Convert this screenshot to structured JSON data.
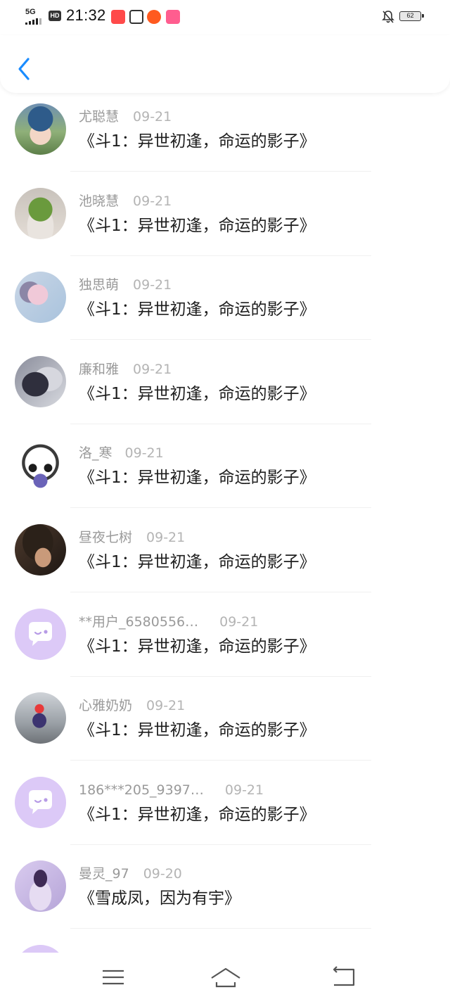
{
  "status_bar": {
    "network": "5G",
    "hd": "HD",
    "time": "21:32",
    "battery": "62",
    "app_icons": [
      "app-icon-1",
      "app-icon-2",
      "app-icon-3",
      "app-icon-4"
    ]
  },
  "header": {
    "back_icon": "chevron-left-icon"
  },
  "items": [
    {
      "user": "尤聪慧",
      "date": "09-21",
      "title": "《斗1：异世初逢，命运的影子》"
    },
    {
      "user": "池晓慧",
      "date": "09-21",
      "title": "《斗1：异世初逢，命运的影子》"
    },
    {
      "user": "独思萌",
      "date": "09-21",
      "title": "《斗1：异世初逢，命运的影子》"
    },
    {
      "user": "廉和雅",
      "date": "09-21",
      "title": "《斗1：异世初逢，命运的影子》"
    },
    {
      "user": "洛_寒",
      "date": "09-21",
      "title": "《斗1：异世初逢，命运的影子》"
    },
    {
      "user": "昼夜七树",
      "date": "09-21",
      "title": "《斗1：异世初逢，命运的影子》"
    },
    {
      "user": "**用户_6580556…",
      "date": "09-21",
      "title": "《斗1：异世初逢，命运的影子》"
    },
    {
      "user": "心雅奶奶",
      "date": "09-21",
      "title": "《斗1：异世初逢，命运的影子》"
    },
    {
      "user": "186***205_9397…",
      "date": "09-21",
      "title": "《斗1：异世初逢，命运的影子》"
    },
    {
      "user": "曼灵_97",
      "date": "09-20",
      "title": "《雪成凤，因为有宇》"
    }
  ],
  "nav": {
    "menu_icon": "menu-icon",
    "home_icon": "home-icon",
    "back_icon": "back-icon"
  },
  "colors": {
    "accent": "#1a8cff",
    "username": "#9a9a9a",
    "date": "#b4b4b4",
    "title": "#1e1e1e",
    "default_avatar": "#dcc9f7"
  }
}
